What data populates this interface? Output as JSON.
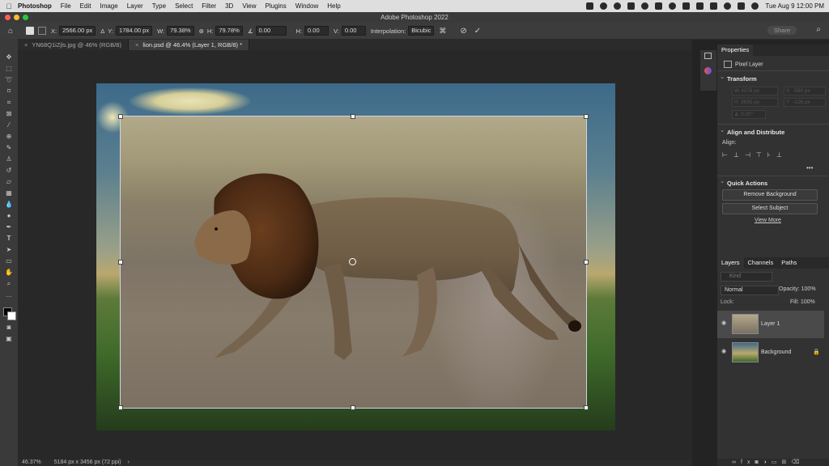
{
  "menubar": {
    "app": "Photoshop",
    "items": [
      "File",
      "Edit",
      "Image",
      "Layer",
      "Type",
      "Select",
      "Filter",
      "3D",
      "View",
      "Plugins",
      "Window",
      "Help"
    ],
    "clock": "Tue Aug 9  12:00 PM"
  },
  "window": {
    "title": "Adobe Photoshop 2022"
  },
  "options": {
    "x_label": "X:",
    "x": "2566.00 px",
    "y_label": "Y:",
    "y": "1784.00 px",
    "w_label": "W:",
    "w": "79.38%",
    "h_label": "H:",
    "h": "79.78%",
    "angle": "0.00",
    "hskew_label": "H:",
    "hskew": "0.00",
    "vskew_label": "V:",
    "vskew": "0.00",
    "interp_label": "Interpolation:",
    "interp": "Bicubic",
    "share": "Share"
  },
  "tabs": [
    {
      "label": "YN68Q1iZjls.jpg @ 46% (RGB/8)"
    },
    {
      "label": "lion.psd @ 46.4% (Layer 1, RGB/8) *"
    }
  ],
  "status": {
    "zoom": "46.37%",
    "info": "5184 px x 3456 px (72 ppi)"
  },
  "properties": {
    "tab": "Properties",
    "kind": "Pixel Layer",
    "transform_title": "Transform",
    "w_label": "W",
    "w": "4378 px",
    "x_label": "X",
    "x": "-588 px",
    "h_label": "H",
    "h": "3695 px",
    "y_label": "Y",
    "y": "-126 px",
    "angle": "0.00°",
    "align_title": "Align and Distribute",
    "align_label": "Align:",
    "quick_title": "Quick Actions",
    "remove_bg": "Remove Background",
    "select_subject": "Select Subject",
    "view_more": "View More"
  },
  "layers_panel": {
    "tabs": [
      "Layers",
      "Channels",
      "Paths"
    ],
    "filter": "Kind",
    "blend": "Normal",
    "opacity_label": "Opacity:",
    "opacity": "100%",
    "lock_label": "Lock:",
    "fill_label": "Fill:",
    "fill": "100%",
    "layers": [
      {
        "name": "Layer 1"
      },
      {
        "name": "Background"
      }
    ]
  },
  "colors": {
    "accent": "#1473e6",
    "panel": "#323232",
    "canvas_bg": "#282828"
  }
}
